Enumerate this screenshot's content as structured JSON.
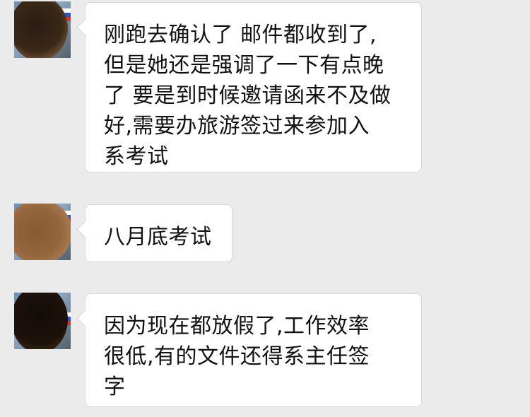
{
  "messages": [
    {
      "lines": [
        "刚跑去确认了 邮件都收到了,",
        "但是她还是强调了一下有点晚",
        "了 要是到时候邀请函来不及做",
        "好,需要办旅游签过来参加入",
        "系考试"
      ]
    },
    {
      "lines": [
        "八月底考试"
      ]
    },
    {
      "lines": [
        "因为现在都放假了,工作效率",
        "很低,有的文件还得系主任签",
        "字"
      ]
    }
  ]
}
